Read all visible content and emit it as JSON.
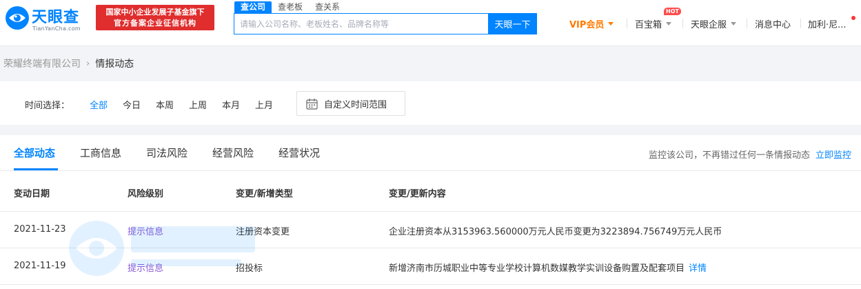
{
  "header": {
    "logo_text": "天眼查",
    "logo_sub": "TianYanCha.com",
    "gov_badge_line1": "国家中小企业发展子基金旗下",
    "gov_badge_line2": "官方备案企业征信机构",
    "search_tabs": [
      "查公司",
      "查老板",
      "查关系"
    ],
    "search_placeholder": "请输入公司名称、老板姓名、品牌名称等",
    "search_button": "天眼一下",
    "nav": {
      "vip": "VIP会员",
      "box": "百宝箱",
      "hot": "HOT",
      "enterprise": "天眼企服",
      "messages": "消息中心",
      "user": "加利·尼..."
    }
  },
  "breadcrumb": {
    "company": "荣耀终端有限公司",
    "separator": "›",
    "current": "情报动态"
  },
  "filter": {
    "label": "时间选择：",
    "options": [
      "全部",
      "今日",
      "本周",
      "上周",
      "本月",
      "上月"
    ],
    "selected": "全部",
    "custom_range": "自定义时间范围"
  },
  "tabs": {
    "items": [
      "全部动态",
      "工商信息",
      "司法风险",
      "经营风险",
      "经营状况"
    ],
    "active": "全部动态",
    "monitor_text": "监控该公司，不再错过任何一条情报动态",
    "monitor_link": "立即监控"
  },
  "table": {
    "headers": [
      "变动日期",
      "风险级别",
      "变更/新增类型",
      "变更/更新内容"
    ],
    "rows": [
      {
        "date": "2021-11-23",
        "risk": "提示信息",
        "type": "注册资本变更",
        "content": "企业注册资本从3153963.560000万元人民币变更为3223894.756749万元人民币",
        "detail": ""
      },
      {
        "date": "2021-11-19",
        "risk": "提示信息",
        "type": "招投标",
        "content": "新增济南市历城职业中等专业学校计算机数媒教学实训设备购置及配套项目",
        "detail": "详情"
      }
    ]
  },
  "colors": {
    "brand_blue": "#0084ff",
    "badge_red": "#e02d2d",
    "vip_orange": "#ff7a00",
    "risk_purple": "#8b5cd6"
  }
}
